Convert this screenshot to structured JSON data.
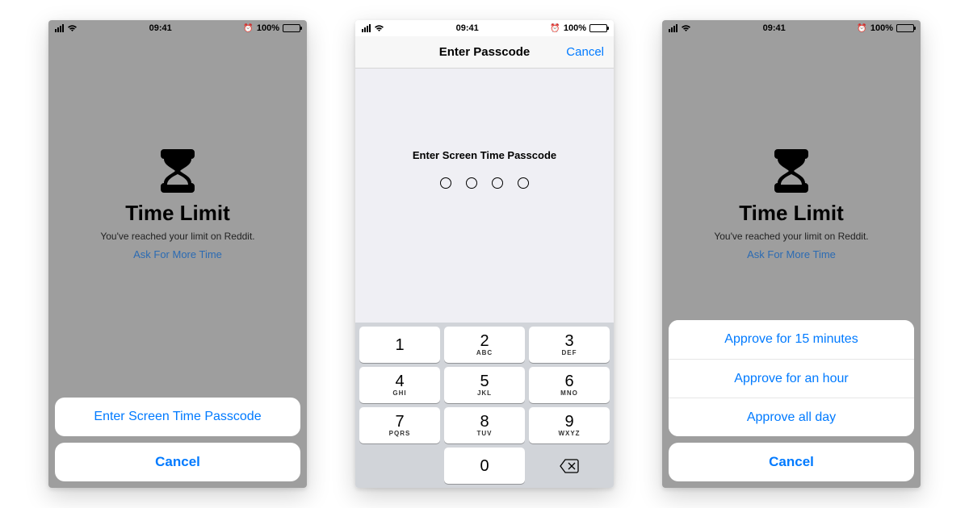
{
  "status": {
    "time": "09:41",
    "battery_pct": "100%"
  },
  "screen1": {
    "title": "Time Limit",
    "subtitle": "You've reached your limit on Reddit.",
    "ask_link": "Ask For More Time",
    "sheet": {
      "enter_passcode": "Enter Screen Time Passcode",
      "cancel": "Cancel"
    }
  },
  "screen2": {
    "nav_title": "Enter Passcode",
    "nav_cancel": "Cancel",
    "prompt": "Enter Screen Time Passcode",
    "keys": {
      "k1": {
        "n": "1",
        "l": ""
      },
      "k2": {
        "n": "2",
        "l": "ABC"
      },
      "k3": {
        "n": "3",
        "l": "DEF"
      },
      "k4": {
        "n": "4",
        "l": "GHI"
      },
      "k5": {
        "n": "5",
        "l": "JKL"
      },
      "k6": {
        "n": "6",
        "l": "MNO"
      },
      "k7": {
        "n": "7",
        "l": "PQRS"
      },
      "k8": {
        "n": "8",
        "l": "TUV"
      },
      "k9": {
        "n": "9",
        "l": "WXYZ"
      },
      "k0": {
        "n": "0",
        "l": ""
      }
    }
  },
  "screen3": {
    "title": "Time Limit",
    "subtitle": "You've reached your limit on Reddit.",
    "ask_link": "Ask For More Time",
    "sheet": {
      "opt1": "Approve for 15 minutes",
      "opt2": "Approve for an hour",
      "opt3": "Approve all day",
      "cancel": "Cancel"
    }
  }
}
